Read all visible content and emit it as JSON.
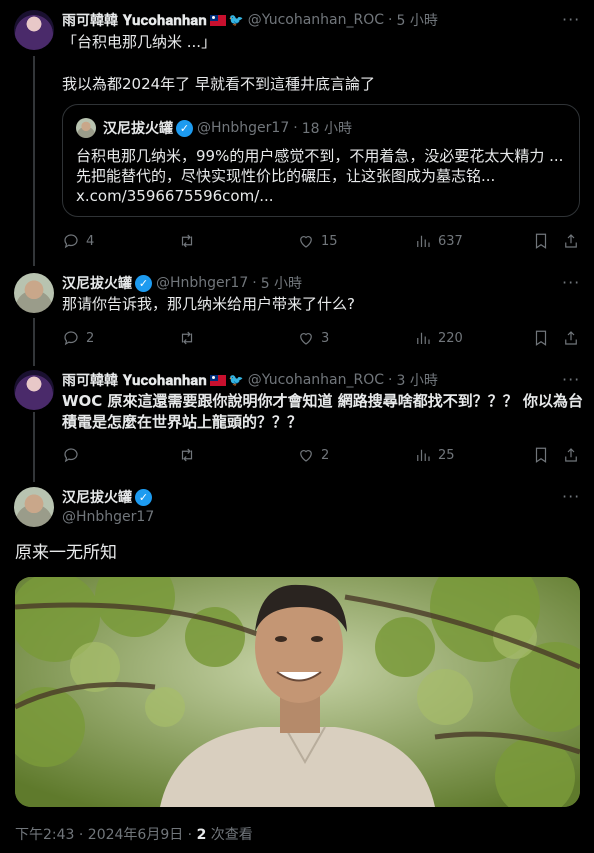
{
  "tweets": [
    {
      "name": "雨可韓韓 𝐘𝐮𝐜𝐨𝐡𝐚𝐧𝐡𝐚𝐧",
      "handle": "@Yucohanhan_ROC",
      "time": "5 小時",
      "text_line1": "「台积电那几纳米 ...」",
      "text_line2": "我以為都2024年了 早就看不到這種井底言論了",
      "quote": {
        "name": "汉尼拔火罐",
        "handle": "@Hnbhger17",
        "time": "18 小時",
        "line1": "台积电那几纳米，99%的用户感觉不到，不用着急，没必要花太大精力 ...",
        "line2": "先把能替代的，尽快实现性价比的碾压，让这张图成为墓志铭...",
        "line3": "x.com/3596675596com/..."
      },
      "replies": "4",
      "retweets": "",
      "likes": "15",
      "views": "637"
    },
    {
      "name": "汉尼拔火罐",
      "handle": "@Hnbhger17",
      "time": "5 小時",
      "text_line1": "那请你告诉我，那几纳米给用户带来了什么?",
      "replies": "2",
      "retweets": "",
      "likes": "3",
      "views": "220"
    },
    {
      "name": "雨可韓韓 𝐘𝐮𝐜𝐨𝐡𝐚𝐧𝐡𝐚𝐧",
      "handle": "@Yucohanhan_ROC",
      "time": "3 小時",
      "text_line1": "WOC 原來這還需要跟你說明你才會知道 網路搜尋啥都找不到？？？ 你以為台",
      "text_line2": "積電是怎麼在世界站上龍頭的？？？",
      "replies": "",
      "retweets": "",
      "likes": "2",
      "views": "25"
    }
  ],
  "main_tweet": {
    "name": "汉尼拔火罐",
    "handle": "@Hnbhger17",
    "text": "原来一无所知"
  },
  "footer": {
    "timestamp": "下午2:43 · 2024年6月9日 · ",
    "views_count": "2",
    "views_label": " 次查看"
  },
  "icons": {
    "verified": "verified-badge-icon",
    "flag": "taiwan-flag-icon",
    "bird": "twitter-bird-icon"
  },
  "colors": {
    "background": "#000000",
    "text": "#e7e9ea",
    "muted": "#71767b",
    "verified": "#1d9bf0",
    "border": "#2f3336"
  }
}
